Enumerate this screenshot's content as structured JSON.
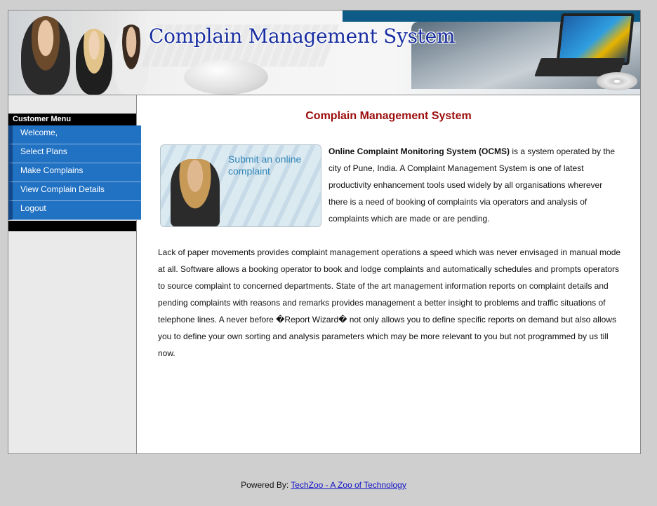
{
  "header": {
    "title": "Complain Management System"
  },
  "sidebar": {
    "heading": "Customer Menu",
    "items": [
      {
        "label": "Welcome,"
      },
      {
        "label": "Select Plans"
      },
      {
        "label": "Make Complains"
      },
      {
        "label": "View Complain Details"
      },
      {
        "label": "Logout"
      }
    ]
  },
  "main": {
    "title": "Complain Management System",
    "promo_image_text": "Submit an online complaint",
    "intro_bold": "Online Complaint Monitoring System (OCMS)",
    "intro_rest": " is a system operated by the city of Pune, India. A Complaint Management System is one of latest productivity enhancement tools used widely by all organisations wherever there is a need of booking of complaints via operators and analysis of complaints which are made or are pending.",
    "paragraph": "Lack of paper movements provides complaint management operations a speed which was never envisaged in manual mode at all. Software allows a booking operator to book and lodge complaints and automatically schedules and prompts operators to source complaint to concerned departments. State of the art management information reports on complaint details and pending complaints with reasons and remarks provides management a better insight to problems and traffic situations of telephone lines. A never before �Report Wizard� not only allows you to define specific reports on demand but also allows you to define your own sorting and analysis parameters which may be more relevant to you but not programmed by us till now."
  },
  "footer": {
    "prefix": "Powered By: ",
    "link_text": "TechZoo - A Zoo of Technology"
  },
  "colors": {
    "menu_item_bg": "#2272c4",
    "title_red": "#9b0c0c",
    "banner_title_blue": "#1a2fa0",
    "page_bg": "#cfcfcf"
  }
}
